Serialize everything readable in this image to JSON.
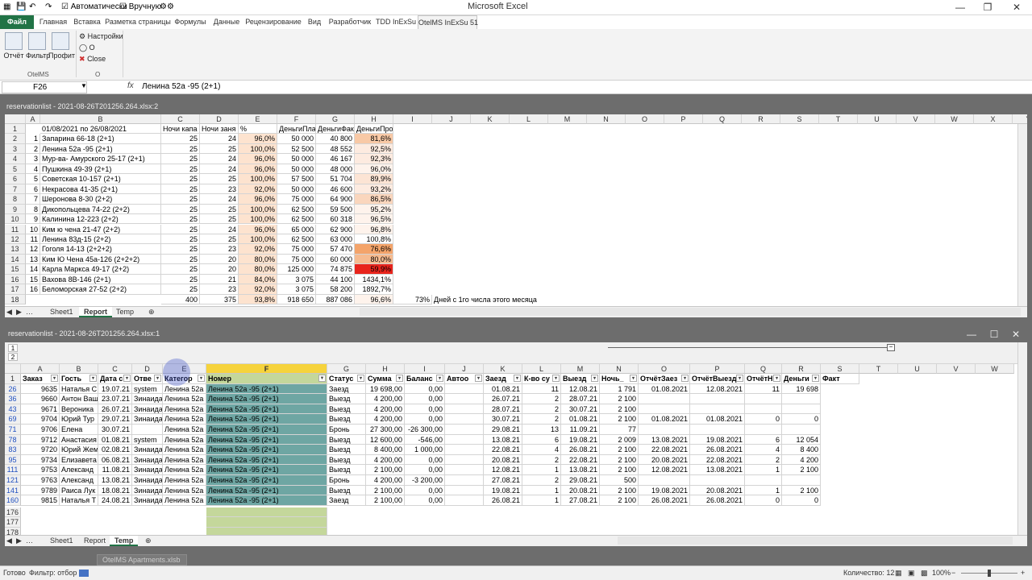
{
  "app": {
    "title": "Microsoft Excel",
    "qa_auto": "Автоматически",
    "qa_manual": "Вручную"
  },
  "tabs": [
    "Файл",
    "Главная",
    "Вставка",
    "Разметка страницы",
    "Формулы",
    "Данные",
    "Рецензирование",
    "Вид",
    "Разработчик",
    "TDD InExSu",
    "OtelMS InExSu 51"
  ],
  "ribbon": {
    "report": "Отчёт",
    "filter": "Фильтр",
    "profit": "Профит",
    "settings": "Настройки",
    "o_small": "О",
    "close": "Close",
    "group1": "OtelMS",
    "group2": "О"
  },
  "formula_bar": {
    "namebox": "F26",
    "fx": "fx",
    "value": "Ленина 52а -95 (2+1)"
  },
  "win1": {
    "title": "reservationlist - 2021-08-26T201256.264.xlsx:2",
    "columns": [
      "A",
      "B",
      "C",
      "D",
      "E",
      "F",
      "G",
      "H",
      "I",
      "J",
      "K",
      "L",
      "M",
      "N",
      "O",
      "P",
      "Q",
      "R",
      "S",
      "T",
      "U",
      "V",
      "W",
      "X",
      "Y"
    ],
    "header_row": {
      "b": "01/08/2021 по 26/08/2021",
      "c": "Ночи капа",
      "d": "Ночи заня",
      "e": "%",
      "f": "ДеньгиПла",
      "g": "ДеньгиФак",
      "h": "ДеньгиПроцент"
    },
    "rows": [
      {
        "n": "2",
        "a": "1",
        "b": "Запарина 66-18 (2+1)",
        "c": "25",
        "d": "24",
        "e": "96,0%",
        "f": "50 000",
        "g": "40 800",
        "h": "81,6%",
        "hc": "#f8c9a6"
      },
      {
        "n": "3",
        "a": "2",
        "b": "Ленина 52а -95 (2+1)",
        "c": "25",
        "d": "25",
        "e": "100,0%",
        "f": "52 500",
        "g": "48 552",
        "h": "92,5%",
        "hc": "#fdebe0"
      },
      {
        "n": "4",
        "a": "3",
        "b": "Мур-ва- Амурского 25-17 (2+1)",
        "c": "25",
        "d": "24",
        "e": "96,0%",
        "f": "50 000",
        "g": "46 167",
        "h": "92,3%",
        "hc": "#fdebe0"
      },
      {
        "n": "5",
        "a": "4",
        "b": "Пушкина 49-39  (2+1)",
        "c": "25",
        "d": "24",
        "e": "96,0%",
        "f": "50 000",
        "g": "48 000",
        "h": "96,0%",
        "hc": "#fef3ec"
      },
      {
        "n": "6",
        "a": "5",
        "b": "Советская 10-157 (2+1)",
        "c": "25",
        "d": "25",
        "e": "100,0%",
        "f": "57 500",
        "g": "51 704",
        "h": "89,9%",
        "hc": "#fce4d4"
      },
      {
        "n": "7",
        "a": "6",
        "b": "Некрасова 41-35 (2+1)",
        "c": "25",
        "d": "23",
        "e": "92,0%",
        "f": "50 000",
        "g": "46 600",
        "h": "93,2%",
        "hc": "#fdebe0"
      },
      {
        "n": "8",
        "a": "7",
        "b": "Шеронова 8-30 (2+2)",
        "c": "25",
        "d": "24",
        "e": "96,0%",
        "f": "75 000",
        "g": "64 900",
        "h": "86,5%",
        "hc": "#fad6bd"
      },
      {
        "n": "9",
        "a": "8",
        "b": "Дикопольцева 74-22 (2+2)",
        "c": "25",
        "d": "25",
        "e": "100,0%",
        "f": "62 500",
        "g": "59 500",
        "h": "95,2%",
        "hc": "#fef3ec"
      },
      {
        "n": "10",
        "a": "9",
        "b": "Калинина 12-223 (2+2)",
        "c": "25",
        "d": "25",
        "e": "100,0%",
        "f": "62 500",
        "g": "60 318",
        "h": "96,5%",
        "hc": "#fef3ec"
      },
      {
        "n": "11",
        "a": "10",
        "b": "Ким ю чена  21-47  (2+2)",
        "c": "25",
        "d": "24",
        "e": "96,0%",
        "f": "65 000",
        "g": "62 900",
        "h": "96,8%",
        "hc": "#fef3ec"
      },
      {
        "n": "12",
        "a": "11",
        "b": "Ленина 83д-15 (2+2)",
        "c": "25",
        "d": "25",
        "e": "100,0%",
        "f": "62 500",
        "g": "63 000",
        "h": "100,8%",
        "hc": "#ffffff"
      },
      {
        "n": "13",
        "a": "12",
        "b": "Гоголя 14-13 (2+2+2)",
        "c": "25",
        "d": "23",
        "e": "92,0%",
        "f": "75 000",
        "g": "57 470",
        "h": "76,6%",
        "hc": "#f4a46a"
      },
      {
        "n": "14",
        "a": "13",
        "b": "Ким Ю Чена 45а-126 (2+2+2)",
        "c": "25",
        "d": "20",
        "e": "80,0%",
        "f": "75 000",
        "g": "60 000",
        "h": "80,0%",
        "hc": "#f6bb90"
      },
      {
        "n": "15",
        "a": "14",
        "b": "Карла Маркса 49-17 (2+2)",
        "c": "25",
        "d": "20",
        "e": "80,0%",
        "f": "125 000",
        "g": "74 875",
        "h": "59,9%",
        "hc": "#e8241c"
      },
      {
        "n": "16",
        "a": "15",
        "b": "Вахова 8В-146 (2+1)",
        "c": "25",
        "d": "21",
        "e": "84,0%",
        "f": "3 075",
        "g": "44 100",
        "h": "1434,1%",
        "hc": "#ffffff"
      },
      {
        "n": "17",
        "a": "16",
        "b": "Беломорская 27-52 (2+2)",
        "c": "25",
        "d": "23",
        "e": "92,0%",
        "f": "3 075",
        "g": "58 200",
        "h": "1892,7%",
        "hc": "#ffffff"
      }
    ],
    "total_row": {
      "n": "18",
      "c": "400",
      "d": "375",
      "e": "93,8%",
      "f": "918 650",
      "g": "887 086",
      "h": "96,6%",
      "i": "73%",
      "j": "Дней с 1го числа этого месяца"
    },
    "sheet_tabs": [
      "Sheet1",
      "Report",
      "Temp"
    ],
    "active_tab": "Report"
  },
  "win2": {
    "title": "reservationlist - 2021-08-26T201256.264.xlsx:1",
    "outline_levels": [
      "1",
      "2"
    ],
    "columns": [
      "A",
      "B",
      "C",
      "D",
      "E",
      "F",
      "G",
      "H",
      "I",
      "J",
      "K",
      "L",
      "M",
      "N",
      "O",
      "P",
      "Q",
      "R",
      "S",
      "T",
      "U",
      "V",
      "W"
    ],
    "headers": [
      "Заказ",
      "Гость",
      "Дата с",
      "Отве",
      "Категор",
      "Номер",
      "Статус",
      "Сумма",
      "Баланс",
      "Автоо",
      "Заезд",
      "К-во су",
      "Выезд",
      "Ночь_",
      "ОтчётЗаез",
      "ОтчётВыезд",
      "ОтчётН",
      "Деньги",
      "Факт"
    ],
    "rows": [
      {
        "n": "26",
        "a": "9635",
        "b": "Наталья С",
        "c": "19.07.21",
        "d": "system",
        "e": "Ленина 52а",
        "f": "Ленина 52а -95 (2+1)",
        "g": "Заезд",
        "h": "19 698,00",
        "i": "0,00",
        "k": "01.08.21",
        "l": "11",
        "m": "12.08.21",
        "nn": "1 791",
        "o": "01.08.2021",
        "p": "12.08.2021",
        "q": "11",
        "r": "19 698"
      },
      {
        "n": "36",
        "a": "9660",
        "b": "Антон Ваш",
        "c": "23.07.21",
        "d": "Зинаида",
        "e": "Ленина 52а",
        "f": "Ленина 52а -95 (2+1)",
        "g": "Выезд",
        "h": "4 200,00",
        "i": "0,00",
        "k": "26.07.21",
        "l": "2",
        "m": "28.07.21",
        "nn": "2 100",
        "o": "",
        "p": "",
        "q": "",
        "r": ""
      },
      {
        "n": "43",
        "a": "9671",
        "b": "Вероника",
        "c": "26.07.21",
        "d": "Зинаида",
        "e": "Ленина 52а",
        "f": "Ленина 52а -95 (2+1)",
        "g": "Выезд",
        "h": "4 200,00",
        "i": "0,00",
        "k": "28.07.21",
        "l": "2",
        "m": "30.07.21",
        "nn": "2 100",
        "o": "",
        "p": "",
        "q": "",
        "r": ""
      },
      {
        "n": "69",
        "a": "9704",
        "b": "Юрий Тур",
        "c": "29.07.21",
        "d": "Зинаида",
        "e": "Ленина 52а",
        "f": "Ленина 52а -95 (2+1)",
        "g": "Выезд",
        "h": "4 200,00",
        "i": "0,00",
        "k": "30.07.21",
        "l": "2",
        "m": "01.08.21",
        "nn": "2 100",
        "o": "01.08.2021",
        "p": "01.08.2021",
        "q": "0",
        "r": "0"
      },
      {
        "n": "71",
        "a": "9706",
        "b": "Елена",
        "c": "30.07.21",
        "d": "",
        "e": "Ленина 52а",
        "f": "Ленина 52а -95 (2+1)",
        "g": "Бронь",
        "h": "27 300,00",
        "i": "-26 300,00",
        "k": "29.08.21",
        "l": "13",
        "m": "11.09.21",
        "nn": "77",
        "o": "",
        "p": "",
        "q": "",
        "r": ""
      },
      {
        "n": "78",
        "a": "9712",
        "b": "Анастасия",
        "c": "01.08.21",
        "d": "system",
        "e": "Ленина 52а",
        "f": "Ленина 52а -95 (2+1)",
        "g": "Выезд",
        "h": "12 600,00",
        "i": "-546,00",
        "k": "13.08.21",
        "l": "6",
        "m": "19.08.21",
        "nn": "2 009",
        "o": "13.08.2021",
        "p": "19.08.2021",
        "q": "6",
        "r": "12 054"
      },
      {
        "n": "83",
        "a": "9720",
        "b": "Юрий Жем",
        "c": "02.08.21",
        "d": "Зинаида",
        "e": "Ленина 52а",
        "f": "Ленина 52а -95 (2+1)",
        "g": "Выезд",
        "h": "8 400,00",
        "i": "1 000,00",
        "k": "22.08.21",
        "l": "4",
        "m": "26.08.21",
        "nn": "2 100",
        "o": "22.08.2021",
        "p": "26.08.2021",
        "q": "4",
        "r": "8 400"
      },
      {
        "n": "95",
        "a": "9734",
        "b": "Елизавета",
        "c": "06.08.21",
        "d": "Зинаида",
        "e": "Ленина 52а",
        "f": "Ленина 52а -95 (2+1)",
        "g": "Выезд",
        "h": "4 200,00",
        "i": "0,00",
        "k": "20.08.21",
        "l": "2",
        "m": "22.08.21",
        "nn": "2 100",
        "o": "20.08.2021",
        "p": "22.08.2021",
        "q": "2",
        "r": "4 200"
      },
      {
        "n": "111",
        "a": "9753",
        "b": "Александ",
        "c": "11.08.21",
        "d": "Зинаида",
        "e": "Ленина 52а",
        "f": "Ленина 52а -95 (2+1)",
        "g": "Выезд",
        "h": "2 100,00",
        "i": "0,00",
        "k": "12.08.21",
        "l": "1",
        "m": "13.08.21",
        "nn": "2 100",
        "o": "12.08.2021",
        "p": "13.08.2021",
        "q": "1",
        "r": "2 100"
      },
      {
        "n": "121",
        "a": "9763",
        "b": "Александ",
        "c": "13.08.21",
        "d": "Зинаида",
        "e": "Ленина 52а",
        "f": "Ленина 52а -95 (2+1)",
        "g": "Бронь",
        "h": "4 200,00",
        "i": "-3 200,00",
        "k": "27.08.21",
        "l": "2",
        "m": "29.08.21",
        "nn": "500",
        "o": "",
        "p": "",
        "q": "",
        "r": ""
      },
      {
        "n": "141",
        "a": "9789",
        "b": "Раиса Лук",
        "c": "18.08.21",
        "d": "Зинаида",
        "e": "Ленина 52а",
        "f": "Ленина 52а -95 (2+1)",
        "g": "Выезд",
        "h": "2 100,00",
        "i": "0,00",
        "k": "19.08.21",
        "l": "1",
        "m": "20.08.21",
        "nn": "2 100",
        "o": "19.08.2021",
        "p": "20.08.2021",
        "q": "1",
        "r": "2 100"
      },
      {
        "n": "160",
        "a": "9815",
        "b": "Наталья Т",
        "c": "24.08.21",
        "d": "Зинаида",
        "e": "Ленина 52а",
        "f": "Ленина 52а -95 (2+1)",
        "g": "Заезд",
        "h": "2 100,00",
        "i": "0,00",
        "k": "26.08.21",
        "l": "1",
        "m": "27.08.21",
        "nn": "2 100",
        "o": "26.08.2021",
        "p": "26.08.2021",
        "q": "0",
        "r": "0"
      }
    ],
    "empty_rows": [
      "176",
      "177",
      "178"
    ],
    "sheet_tabs": [
      "Sheet1",
      "Report",
      "Temp"
    ],
    "active_tab": "Temp"
  },
  "minimized_window": "OtelMS Apartments.xlsb",
  "status": {
    "ready": "Готово",
    "filter": "Фильтр: отбор",
    "count": "Количество: 12",
    "zoom": "100%"
  }
}
